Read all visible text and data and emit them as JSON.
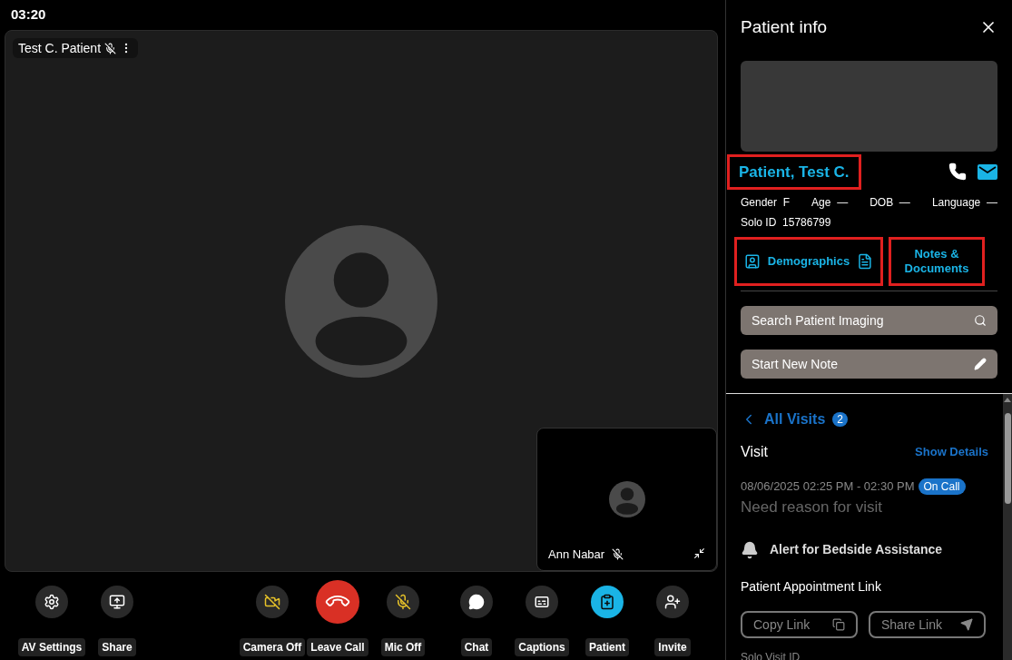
{
  "timer": "03:20",
  "main_tile": {
    "name": "Test C. Patient",
    "muted": true
  },
  "self_tile": {
    "name": "Ann Nabar",
    "muted": true
  },
  "controls": {
    "left": [
      {
        "label": "AV Settings",
        "kind": "settings",
        "off": false,
        "selected": false
      },
      {
        "label": "Share",
        "kind": "share",
        "off": false,
        "selected": false
      }
    ],
    "center": [
      {
        "label": "Camera Off",
        "kind": "camera",
        "off": true,
        "selected": false
      },
      {
        "label": "Leave Call",
        "kind": "leave",
        "off": false,
        "selected": false
      },
      {
        "label": "Mic Off",
        "kind": "mic",
        "off": true,
        "selected": false
      }
    ],
    "right": [
      {
        "label": "Chat",
        "kind": "chat",
        "off": false,
        "selected": false
      },
      {
        "label": "Captions",
        "kind": "captions",
        "off": false,
        "selected": false
      },
      {
        "label": "Patient",
        "kind": "patient",
        "off": false,
        "selected": true
      },
      {
        "label": "Invite",
        "kind": "invite",
        "off": false,
        "selected": false
      }
    ]
  },
  "panel": {
    "title": "Patient info",
    "patient_name": {
      "text": "Patient, Test C.",
      "highlighted": true
    },
    "fields": [
      {
        "label": "Gender",
        "value": "F"
      },
      {
        "label": "Age",
        "value": "—"
      },
      {
        "label": "DOB",
        "value": "—"
      },
      {
        "label": "Language",
        "value": "—"
      }
    ],
    "solo_id": {
      "label": "Solo ID",
      "value": "15786799"
    },
    "tabs": [
      {
        "label": "Demographics",
        "highlighted": true
      },
      {
        "label": "Notes & Documents",
        "highlighted": true
      }
    ],
    "actions": [
      {
        "label": "Search Patient Imaging",
        "kind": "search"
      },
      {
        "label": "Start New Note",
        "kind": "edit"
      }
    ],
    "visits": {
      "title": "All Visits",
      "count": "2",
      "visit_label": "Visit",
      "show_details": "Show Details",
      "time": "08/06/2025 02:25 PM - 02:30 PM",
      "status": "On Call",
      "reason": "Need reason for visit",
      "alert": "Alert for Bedside Assistance",
      "link_title": "Patient Appointment Link",
      "link_buttons": [
        {
          "label": "Copy Link",
          "kind": "copy"
        },
        {
          "label": "Share Link",
          "kind": "send"
        }
      ],
      "visit_id_label": "Solo Visit ID"
    }
  }
}
